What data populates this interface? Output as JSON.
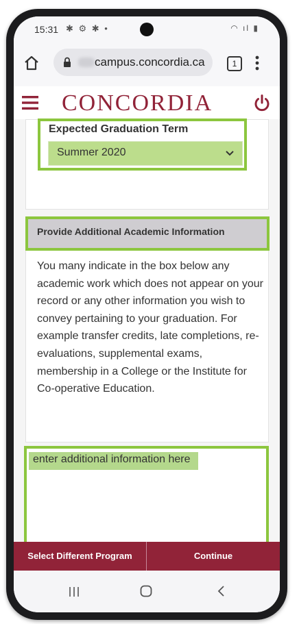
{
  "status_bar": {
    "time": "15:31",
    "notification_icons": "✱ ⚙ ✱ •",
    "system_icons": "◠ ıl ▮"
  },
  "browser": {
    "url": "campus.concordia.ca",
    "tab_count": "1"
  },
  "site_header": {
    "logo_text": "CONCORDIA"
  },
  "graduation": {
    "label": "Expected Graduation Term",
    "selected_term": "Summer 2020"
  },
  "additional_info": {
    "section_title": "Provide Additional Academic Information",
    "description": "You many indicate in the box below any academic work which does not appear on your record or any other information you wish to convey pertaining to your graduation. For example transfer credits, late completions, re-evaluations, supplemental exams, membership in a College or the Institute for Co-operative Education.",
    "textarea_placeholder": "enter additional information here"
  },
  "actions": {
    "select_program_label": "Select Different Program",
    "continue_label": "Continue"
  },
  "colors": {
    "brand": "#912338",
    "highlight": "#8cc63e",
    "highlight_fill": "#bcdd8c",
    "section_bar": "#cfcdd1"
  }
}
